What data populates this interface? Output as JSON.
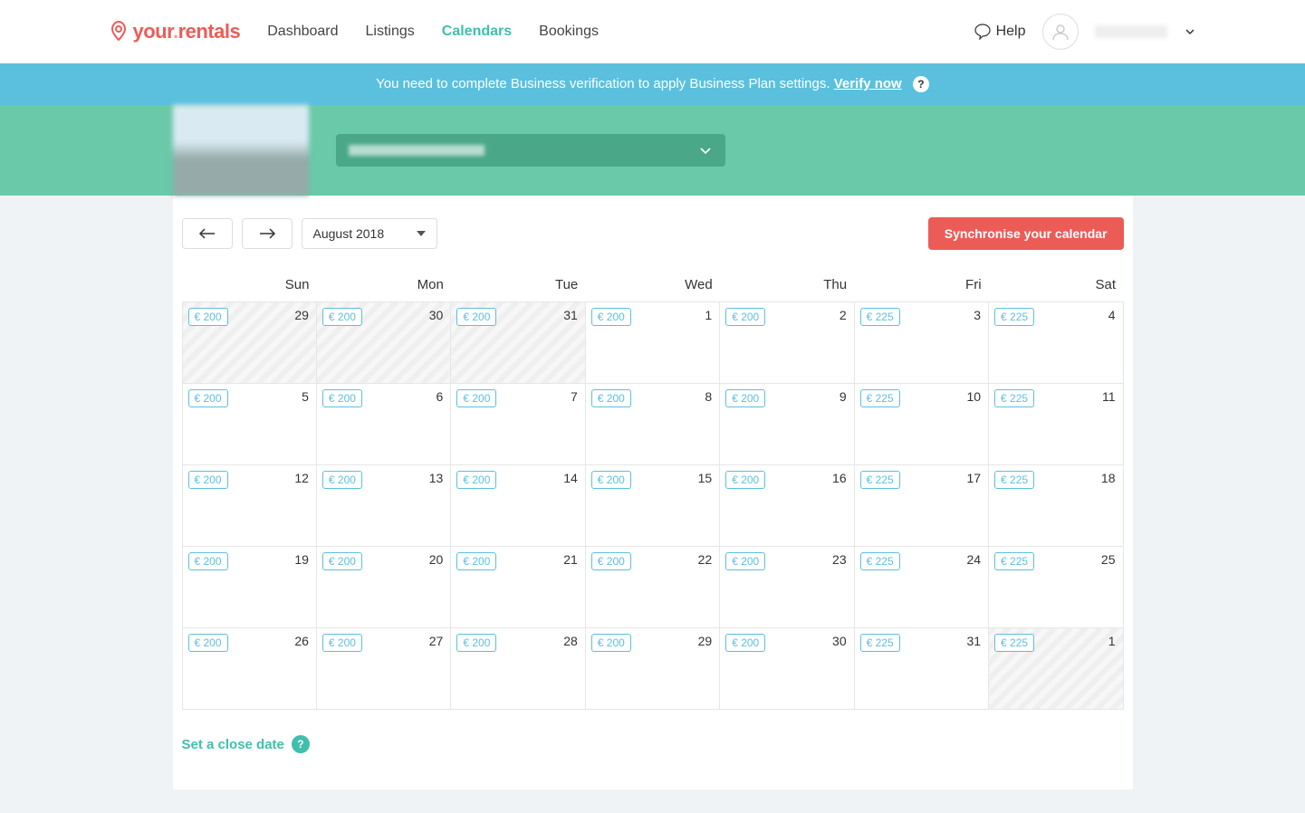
{
  "header": {
    "brand_part1": "your",
    "brand_part2": "rentals",
    "nav": {
      "dashboard": "Dashboard",
      "listings": "Listings",
      "calendars": "Calendars",
      "bookings": "Bookings"
    },
    "help": "Help"
  },
  "notice": {
    "text": "You need to complete Business verification to apply Business Plan settings. ",
    "link": "Verify now",
    "help_char": "?"
  },
  "toolbar": {
    "month": "August 2018",
    "sync": "Synchronise your calendar"
  },
  "calendar": {
    "days": [
      "Sun",
      "Mon",
      "Tue",
      "Wed",
      "Thu",
      "Fri",
      "Sat"
    ],
    "weeks": [
      [
        {
          "d": "29",
          "p": "€ 200",
          "out": true
        },
        {
          "d": "30",
          "p": "€ 200",
          "out": true
        },
        {
          "d": "31",
          "p": "€ 200",
          "out": true
        },
        {
          "d": "1",
          "p": "€ 200"
        },
        {
          "d": "2",
          "p": "€ 200"
        },
        {
          "d": "3",
          "p": "€ 225"
        },
        {
          "d": "4",
          "p": "€ 225"
        }
      ],
      [
        {
          "d": "5",
          "p": "€ 200"
        },
        {
          "d": "6",
          "p": "€ 200"
        },
        {
          "d": "7",
          "p": "€ 200"
        },
        {
          "d": "8",
          "p": "€ 200"
        },
        {
          "d": "9",
          "p": "€ 200"
        },
        {
          "d": "10",
          "p": "€ 225"
        },
        {
          "d": "11",
          "p": "€ 225"
        }
      ],
      [
        {
          "d": "12",
          "p": "€ 200"
        },
        {
          "d": "13",
          "p": "€ 200"
        },
        {
          "d": "14",
          "p": "€ 200"
        },
        {
          "d": "15",
          "p": "€ 200"
        },
        {
          "d": "16",
          "p": "€ 200"
        },
        {
          "d": "17",
          "p": "€ 225"
        },
        {
          "d": "18",
          "p": "€ 225"
        }
      ],
      [
        {
          "d": "19",
          "p": "€ 200"
        },
        {
          "d": "20",
          "p": "€ 200"
        },
        {
          "d": "21",
          "p": "€ 200"
        },
        {
          "d": "22",
          "p": "€ 200"
        },
        {
          "d": "23",
          "p": "€ 200"
        },
        {
          "d": "24",
          "p": "€ 225"
        },
        {
          "d": "25",
          "p": "€ 225"
        }
      ],
      [
        {
          "d": "26",
          "p": "€ 200"
        },
        {
          "d": "27",
          "p": "€ 200"
        },
        {
          "d": "28",
          "p": "€ 200"
        },
        {
          "d": "29",
          "p": "€ 200"
        },
        {
          "d": "30",
          "p": "€ 200"
        },
        {
          "d": "31",
          "p": "€ 225"
        },
        {
          "d": "1",
          "p": "€ 225",
          "out": true
        }
      ]
    ]
  },
  "footer": {
    "close_date": "Set a close date",
    "q": "?"
  }
}
